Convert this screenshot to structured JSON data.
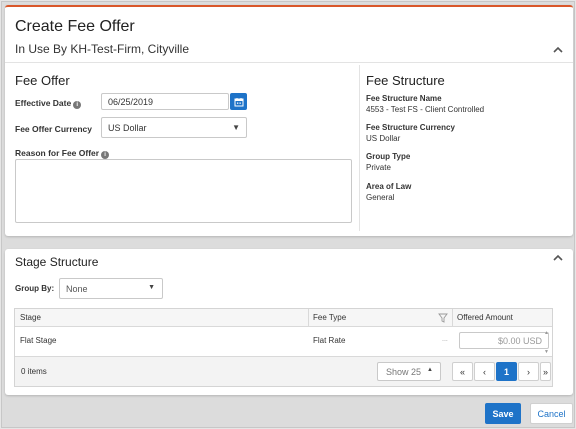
{
  "header": {
    "title": "Create Fee Offer",
    "subtitle": "In Use By KH-Test-Firm, Cityville"
  },
  "fee_offer": {
    "heading": "Fee Offer",
    "effective_date_label": "Effective Date",
    "effective_date_value": "06/25/2019",
    "currency_label": "Fee Offer Currency",
    "currency_value": "US Dollar",
    "reason_label": "Reason for Fee Offer",
    "reason_value": ""
  },
  "fee_structure": {
    "heading": "Fee Structure",
    "name_label": "Fee Structure Name",
    "name_value": "4553 - Test FS - Client Controlled",
    "currency_label": "Fee Structure Currency",
    "currency_value": "US Dollar",
    "group_type_label": "Group Type",
    "group_type_value": "Private",
    "area_of_law_label": "Area of Law",
    "area_of_law_value": "General"
  },
  "stage_structure": {
    "heading": "Stage Structure",
    "group_by_label": "Group By:",
    "group_by_value": "None",
    "columns": [
      "Stage",
      "Fee Type",
      "Offered Amount"
    ],
    "rows": [
      {
        "stage": "Flat Stage",
        "fee_type": "Flat Rate",
        "extra": "...",
        "offered_amount": "$0.00 USD"
      }
    ],
    "items_count": "0 items",
    "page_size_label": "Show 25",
    "pager": {
      "first": "«",
      "prev": "‹",
      "current": "1",
      "next": "›",
      "last": "»"
    }
  },
  "footer": {
    "save_label": "Save",
    "cancel_label": "Cancel"
  },
  "colors": {
    "accent": "#1e73c8",
    "top_border": "#d9572a"
  },
  "icons": [
    "chevron-up-icon",
    "info-icon",
    "calendar-icon",
    "caret-down-icon",
    "filter-icon",
    "caret-up-icon"
  ]
}
